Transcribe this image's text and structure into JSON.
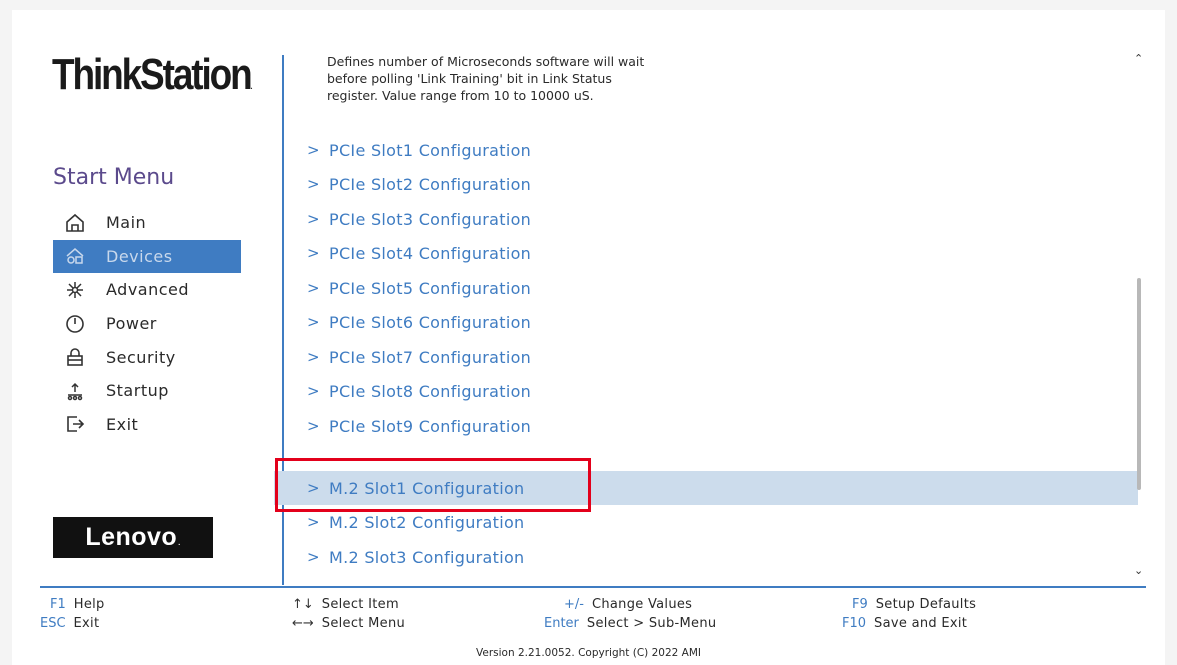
{
  "brand": {
    "product_logo": "ThinkStation",
    "vendor_logo": "Lenovo"
  },
  "sidebar": {
    "title": "Start Menu",
    "items": [
      {
        "label": "Main",
        "icon": "home-icon"
      },
      {
        "label": "Devices",
        "icon": "devices-icon",
        "active": true
      },
      {
        "label": "Advanced",
        "icon": "advanced-icon"
      },
      {
        "label": "Power",
        "icon": "power-icon"
      },
      {
        "label": "Security",
        "icon": "lock-icon"
      },
      {
        "label": "Startup",
        "icon": "startup-icon"
      },
      {
        "label": "Exit",
        "icon": "exit-icon"
      }
    ]
  },
  "main": {
    "help_text": [
      "Defines number of Microseconds software will wait",
      "before polling 'Link Training' bit in Link Status",
      "register. Value range from 10 to 10000 uS."
    ],
    "items": [
      {
        "label": "PCIe Slot1 Configuration"
      },
      {
        "label": "PCIe Slot2 Configuration"
      },
      {
        "label": "PCIe Slot3 Configuration"
      },
      {
        "label": "PCIe Slot4 Configuration"
      },
      {
        "label": "PCIe Slot5 Configuration"
      },
      {
        "label": "PCIe Slot6 Configuration"
      },
      {
        "label": "PCIe Slot7 Configuration"
      },
      {
        "label": "PCIe Slot8 Configuration"
      },
      {
        "label": "PCIe Slot9 Configuration"
      },
      {
        "label": "M.2 Slot1 Configuration",
        "selected": true
      },
      {
        "label": "M.2 Slot2 Configuration"
      },
      {
        "label": "M.2 Slot3 Configuration"
      }
    ],
    "submenu_marker": ">"
  },
  "footer": {
    "keys": [
      {
        "key": "F1",
        "desc": "Help"
      },
      {
        "key": "ESC",
        "desc": "Exit"
      },
      {
        "key": "↑↓",
        "desc": "Select Item"
      },
      {
        "key": "←→",
        "desc": "Select Menu"
      },
      {
        "key": "+/-",
        "desc": "Change Values"
      },
      {
        "key": "Enter",
        "desc": "Select > Sub-Menu"
      },
      {
        "key": "F9",
        "desc": "Setup Defaults"
      },
      {
        "key": "F10",
        "desc": "Save and Exit"
      }
    ],
    "version": "Version 2.21.0052. Copyright (C) 2022 AMI"
  },
  "colors": {
    "accent": "#3f7cc2",
    "highlight": "#e3001b",
    "selected_row": "#ccdcec",
    "title": "#5b4a8c"
  }
}
